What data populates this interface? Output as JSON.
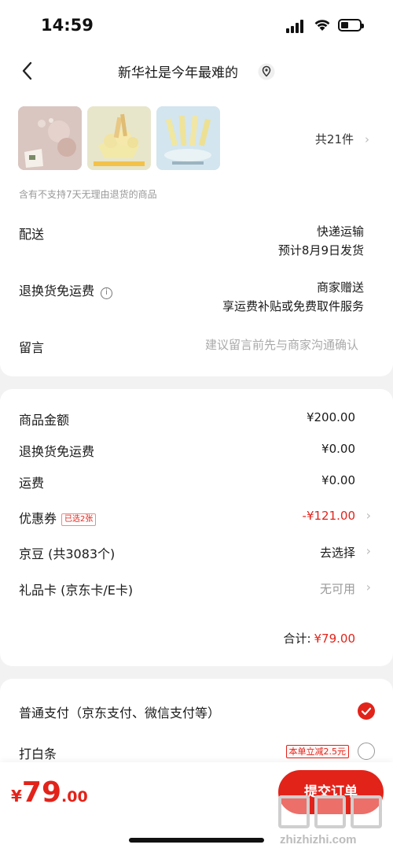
{
  "status": {
    "time": "14:59"
  },
  "nav": {
    "title": "新华社是今年最难的"
  },
  "order": {
    "item_count": "共21件",
    "return_note": "含有不支持7天无理由退货的商品",
    "delivery": {
      "label": "配送",
      "method": "快递运输",
      "eta": "预计8月9日发货"
    },
    "free_return": {
      "label": "退换货免运费",
      "info": "i",
      "value": "商家赠送",
      "desc": "享运费补贴或免费取件服务"
    },
    "message": {
      "label": "留言",
      "placeholder": "建议留言前先与商家沟通确认"
    }
  },
  "fees": {
    "goods": {
      "label": "商品金额",
      "value": "¥200.00"
    },
    "return_fee": {
      "label": "退换货免运费",
      "value": "¥0.00"
    },
    "shipping": {
      "label": "运费",
      "value": "¥0.00"
    },
    "coupon": {
      "label": "优惠券",
      "tag": "已选2张",
      "value": "-¥121.00"
    },
    "jingdou": {
      "label": "京豆 (共3083个)",
      "value": "去选择"
    },
    "giftcard": {
      "label": "礼品卡 (京东卡/E卡)",
      "value": "无可用"
    },
    "total_label": "合计:",
    "total_value": "¥79.00"
  },
  "payment": {
    "normal": {
      "label": "普通支付（京东支付、微信支付等）",
      "selected": true
    },
    "baitiao": {
      "label": "打白条",
      "promo": "本单立减2.5元",
      "selected": false
    }
  },
  "footer": {
    "currency": "¥",
    "price_int": "79",
    "price_dec": ".00",
    "submit": "提交订单",
    "watermark": "zhizhizhi.com"
  },
  "colors": {
    "accent": "#e2231a"
  }
}
